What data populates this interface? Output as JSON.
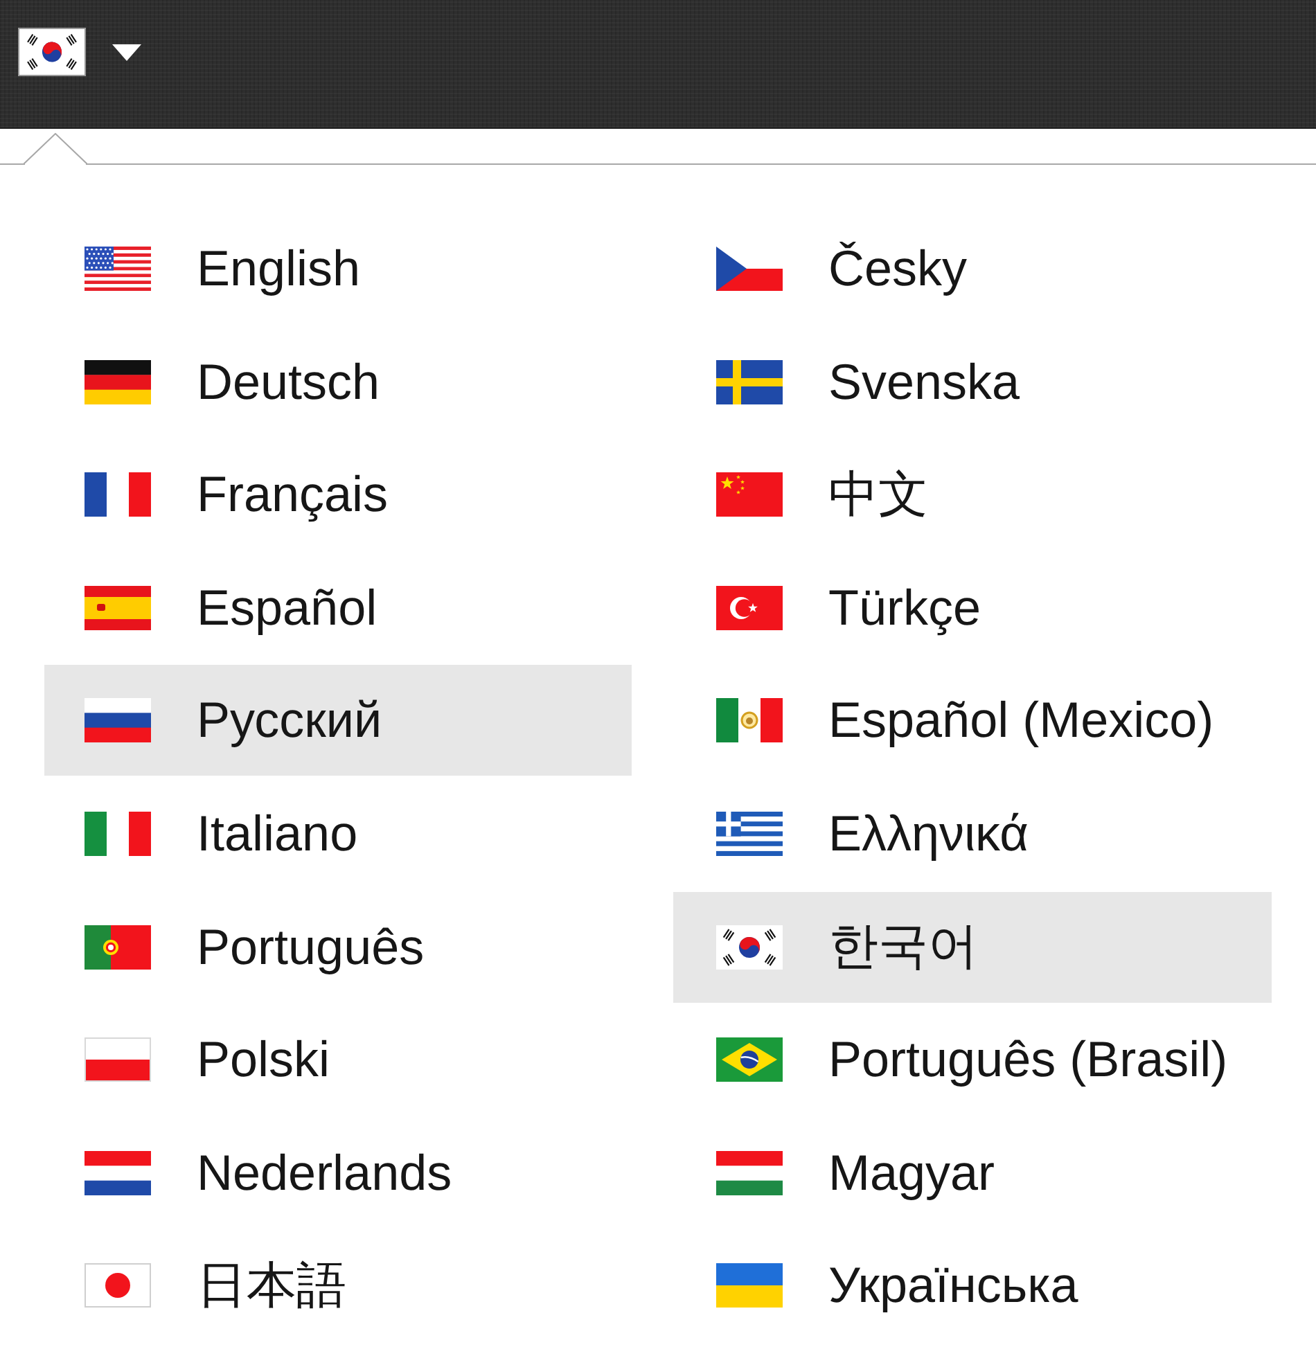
{
  "language_button": {
    "kind": "kr"
  },
  "columns": [
    {
      "items": [
        {
          "label": "English",
          "kind": "us",
          "highlighted": false
        },
        {
          "label": "Deutsch",
          "kind": "de",
          "highlighted": false
        },
        {
          "label": "Français",
          "kind": "fr",
          "highlighted": false
        },
        {
          "label": "Español",
          "kind": "es",
          "highlighted": false
        },
        {
          "label": "Русский",
          "kind": "ru",
          "highlighted": true
        },
        {
          "label": "Italiano",
          "kind": "it",
          "highlighted": false
        },
        {
          "label": "Português",
          "kind": "pt",
          "highlighted": false
        },
        {
          "label": "Polski",
          "kind": "pl",
          "highlighted": false
        },
        {
          "label": "Nederlands",
          "kind": "nl",
          "highlighted": false
        },
        {
          "label": "日本語",
          "kind": "jp",
          "highlighted": false
        }
      ]
    },
    {
      "items": [
        {
          "label": "Česky",
          "kind": "cz",
          "highlighted": false
        },
        {
          "label": "Svenska",
          "kind": "se",
          "highlighted": false
        },
        {
          "label": "中文",
          "kind": "cn",
          "highlighted": false
        },
        {
          "label": "Türkçe",
          "kind": "tr",
          "highlighted": false
        },
        {
          "label": "Español (Mexico)",
          "kind": "mx",
          "highlighted": false
        },
        {
          "label": "Ελληνικά",
          "kind": "gr",
          "highlighted": false
        },
        {
          "label": "한국어",
          "kind": "kr",
          "highlighted": true
        },
        {
          "label": "Português (Brasil)",
          "kind": "br",
          "highlighted": false
        },
        {
          "label": "Magyar",
          "kind": "hu",
          "highlighted": false
        },
        {
          "label": "Українська",
          "kind": "ua",
          "highlighted": false
        }
      ]
    }
  ]
}
